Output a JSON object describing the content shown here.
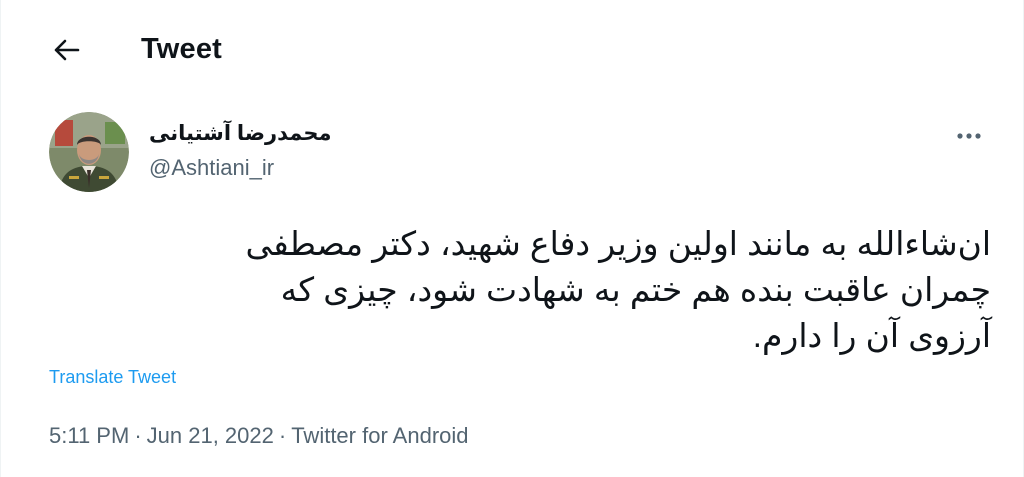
{
  "header": {
    "back_icon": "arrow-left-icon",
    "title": "Tweet"
  },
  "tweet": {
    "author": {
      "display_name": "محمدرضا آشتیانی",
      "handle": "@Ashtiani_ir",
      "avatar_icon": "profile-photo-avatar"
    },
    "more_icon": "more-horizontal-icon",
    "text_lines": [
      "ان‌شاءالله به مانند اولین وزیر دفاع شهید، دکتر مصطفی",
      "چمران عاقبت بنده هم ختم به شهادت شود، چیزی که",
      "آرزوی آن را دارم."
    ],
    "translate_label": "Translate Tweet",
    "time": "5:11 PM",
    "separator": "·",
    "date": "Jun 21, 2022",
    "source": "Twitter for Android"
  },
  "colors": {
    "text_primary": "#0f1419",
    "text_secondary": "#536471",
    "link": "#1d9bf0",
    "border": "#eff3f4"
  }
}
